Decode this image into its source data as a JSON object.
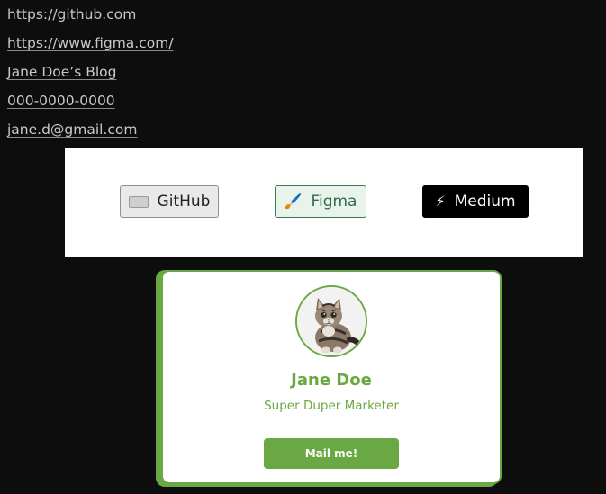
{
  "links": [
    {
      "label": "https://github.com"
    },
    {
      "label": "https://www.figma.com/"
    },
    {
      "label": "Jane Doe’s Blog"
    },
    {
      "label": "000-0000-0000"
    },
    {
      "label": "jane.d@gmail.com"
    }
  ],
  "buttons": {
    "github": {
      "label": "GitHub",
      "icon": "keyboard-icon"
    },
    "figma": {
      "label": "Figma",
      "icon": "paintbrush-icon",
      "emoji": "🖌️"
    },
    "medium": {
      "label": "Medium",
      "icon": "lightning-icon",
      "emoji": "⚡"
    }
  },
  "profile": {
    "name": "Jane Doe",
    "role": "Super Duper Marketer",
    "mail_label": "Mail me!",
    "avatar": "kitten-avatar",
    "accent": "#6aa843"
  }
}
